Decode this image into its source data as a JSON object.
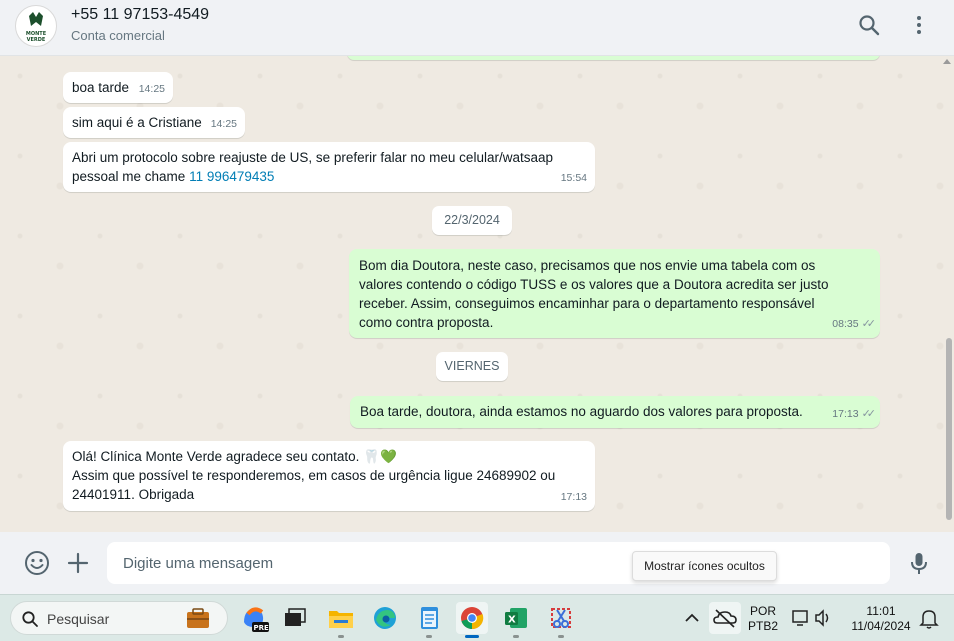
{
  "header": {
    "contact_name": "+55 11 97153-4549",
    "contact_subtitle": "Conta comercial",
    "avatar_logo_text": "MONTE VERDE",
    "icons": [
      "search-icon",
      "menu-dots-icon"
    ]
  },
  "messages": [
    {
      "type": "incoming",
      "text": "boa tarde",
      "time": "14:25"
    },
    {
      "type": "incoming",
      "text": "sim aqui é a Cristiane",
      "time": "14:25"
    },
    {
      "type": "incoming",
      "text_line1": "Abri um protocolo sobre reajuste de US, se preferir falar no meu celular/watsaap",
      "text_line2_prefix": "pessoal me chame ",
      "link": "11 996479435",
      "time": "15:54"
    },
    {
      "type": "date",
      "text": "22/3/2024"
    },
    {
      "type": "outgoing",
      "text": "Bom dia Doutora, neste caso, precisamos que nos envie uma tabela com os valores contendo o código TUSS e os valores que a Doutora acredita ser justo receber. Assim, conseguimos encaminhar para o departamento responsável como contra proposta.",
      "time": "08:35",
      "status": "delivered"
    },
    {
      "type": "date",
      "text": "VIERNES"
    },
    {
      "type": "outgoing",
      "text": "Boa tarde, doutora, ainda estamos no aguardo dos valores para proposta.",
      "time": "17:13",
      "status": "delivered"
    },
    {
      "type": "incoming",
      "text_line1": "Olá! Clínica Monte Verde agradece seu contato. 🦷💚",
      "text_line2": "Assim que possível te responderemos, em casos de urgência ligue 24689902 ou 24401911. Obrigada",
      "time": "17:13"
    }
  ],
  "composer": {
    "placeholder": "Digite uma mensagem",
    "value": "",
    "tooltip": "Mostrar ícones ocultos"
  },
  "taskbar": {
    "search_label": "Pesquisar",
    "apps": [
      "briefcase-icon",
      "copilot-pre-icon",
      "task-view-icon",
      "file-explorer-icon",
      "edge-icon",
      "notepad-icon",
      "chrome-icon",
      "excel-icon",
      "snipping-tool-icon"
    ],
    "lang_line1": "POR",
    "lang_line2": "PTB2",
    "time": "11:01",
    "date": "11/04/2024"
  },
  "colors": {
    "incoming_bubble": "#ffffff",
    "outgoing_bubble": "#d9fdd3",
    "chat_background": "#efeae2",
    "link": "#027eb5"
  }
}
